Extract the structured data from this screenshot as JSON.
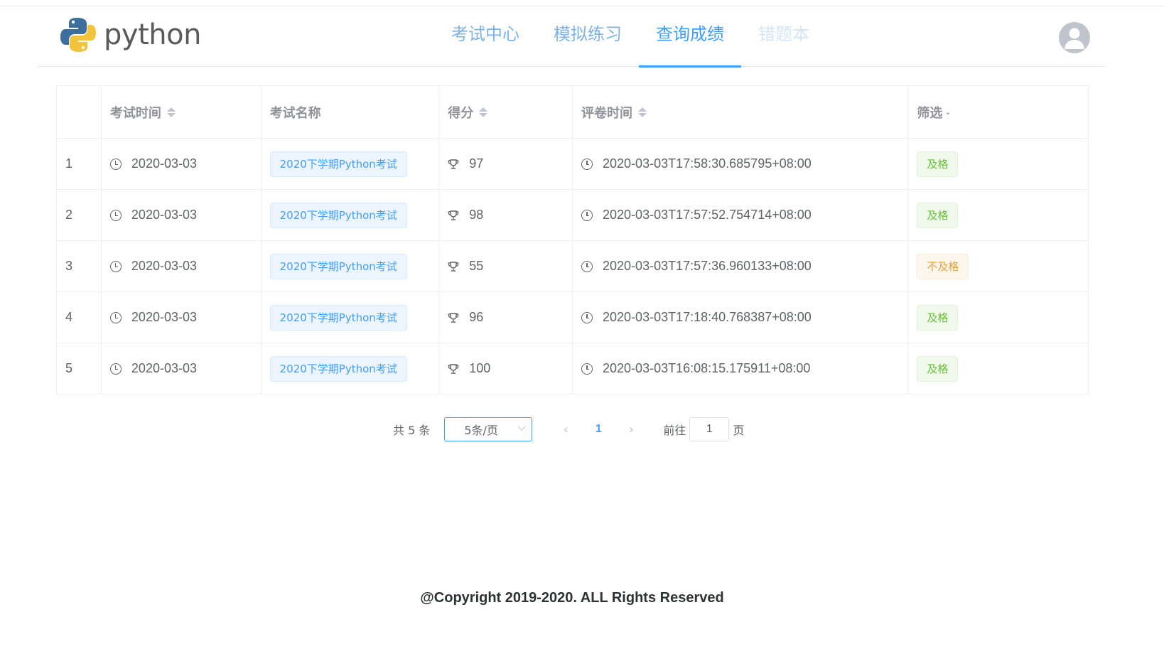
{
  "app": {
    "logo_text": "python"
  },
  "nav": {
    "items": [
      {
        "label": "考试中心"
      },
      {
        "label": "模拟练习"
      },
      {
        "label": "查询成绩"
      },
      {
        "label": "错题本"
      }
    ],
    "active_index": 2
  },
  "table": {
    "headers": {
      "index": "",
      "exam_time": "考试时间",
      "exam_name": "考试名称",
      "score": "得分",
      "grade_time": "评卷时间",
      "filter": "筛选"
    },
    "rows": [
      {
        "index": "1",
        "exam_time": "2020-03-03",
        "exam_name": "2020下学期Python考试",
        "score": "97",
        "grade_time": "2020-03-03T17:58:30.685795+08:00",
        "status": "及格",
        "status_type": "pass"
      },
      {
        "index": "2",
        "exam_time": "2020-03-03",
        "exam_name": "2020下学期Python考试",
        "score": "98",
        "grade_time": "2020-03-03T17:57:52.754714+08:00",
        "status": "及格",
        "status_type": "pass"
      },
      {
        "index": "3",
        "exam_time": "2020-03-03",
        "exam_name": "2020下学期Python考试",
        "score": "55",
        "grade_time": "2020-03-03T17:57:36.960133+08:00",
        "status": "不及格",
        "status_type": "fail"
      },
      {
        "index": "4",
        "exam_time": "2020-03-03",
        "exam_name": "2020下学期Python考试",
        "score": "96",
        "grade_time": "2020-03-03T17:18:40.768387+08:00",
        "status": "及格",
        "status_type": "pass"
      },
      {
        "index": "5",
        "exam_time": "2020-03-03",
        "exam_name": "2020下学期Python考试",
        "score": "100",
        "grade_time": "2020-03-03T16:08:15.175911+08:00",
        "status": "及格",
        "status_type": "pass"
      }
    ]
  },
  "pagination": {
    "total": "共 5 条",
    "page_size": "5条/页",
    "current_page": "1",
    "goto_label": "前往",
    "goto_value": "1",
    "page_suffix": "页"
  },
  "footer": {
    "copyright": "@Copyright 2019-2020. ALL Rights Reserved"
  },
  "colors": {
    "accent": "#409eff",
    "pass": "#67c23a",
    "fail": "#e6a23c"
  },
  "icons": {
    "clock": "clock-icon",
    "trophy": "trophy-icon",
    "user": "user-avatar-icon"
  }
}
